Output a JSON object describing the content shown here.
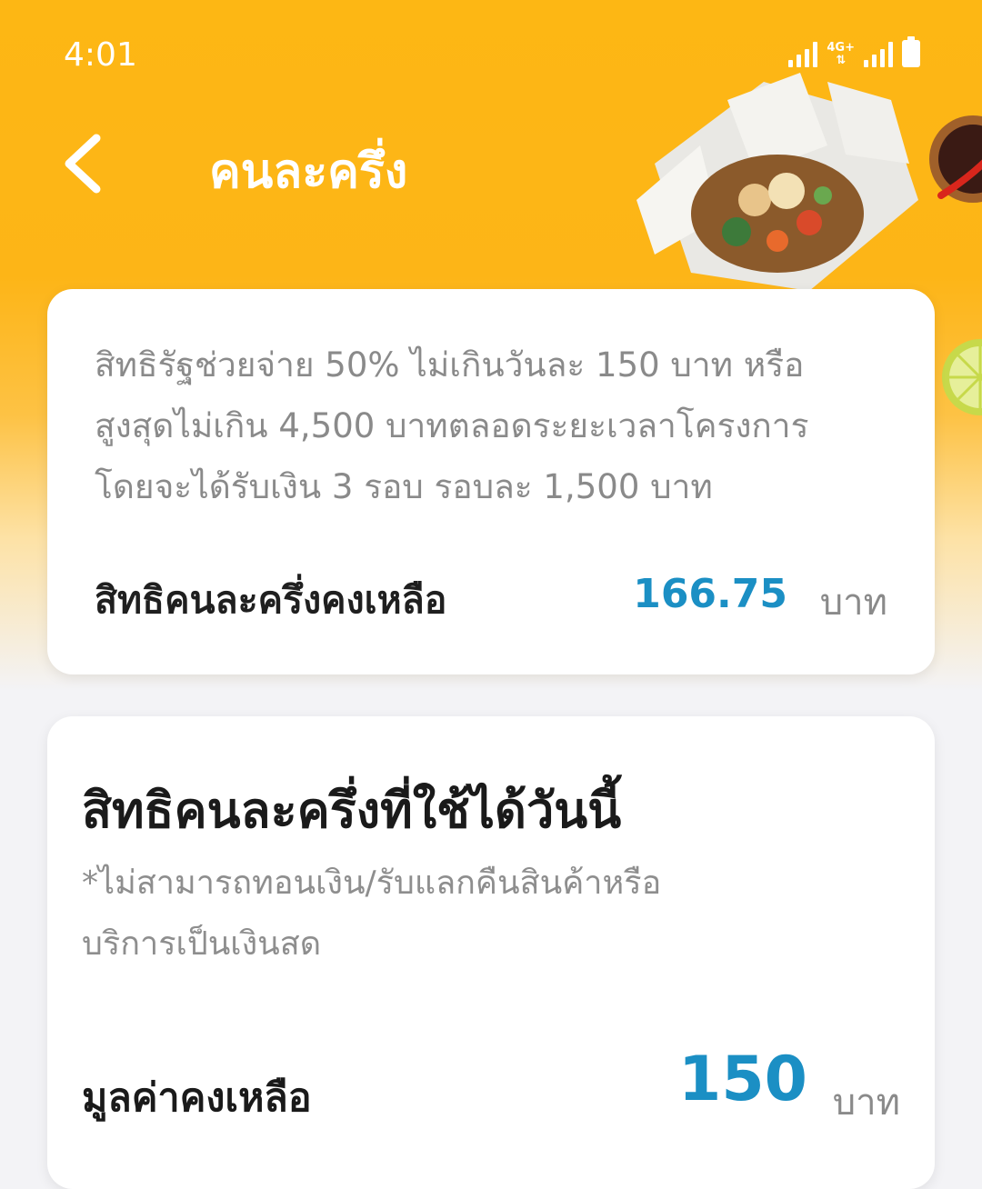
{
  "status_bar": {
    "time": "4:01",
    "network_label": "4G+"
  },
  "header": {
    "title": "คนละครึ่ง",
    "back_icon": "chevron-left-icon"
  },
  "balance_card": {
    "info_lines": [
      "สิทธิรัฐช่วยจ่าย 50% ไม่เกินวันละ 150 บาท หรือ",
      "สูงสุดไม่เกิน 4,500 บาทตลอดระยะเวลาโครงการ",
      "โดยจะได้รับเงิน 3 รอบ รอบละ 1,500 บาท"
    ],
    "remaining_label": "สิทธิคนละครึ่งคงเหลือ",
    "remaining_amount": "166.75",
    "unit": "บาท"
  },
  "today_card": {
    "title": "สิทธิคนละครึ่งที่ใช้ได้วันนี้",
    "note_lines": [
      "*ไม่สามารถทอนเงิน/รับแลกคืนสินค้าหรือ",
      "บริการเป็นเงินสด"
    ],
    "value_label": "มูลค่าคงเหลือ",
    "value_amount": "150",
    "unit": "บาท"
  },
  "colors": {
    "header_orange": "#fdb714",
    "amount_blue": "#1b8fc4",
    "background": "#f3f3f6"
  }
}
